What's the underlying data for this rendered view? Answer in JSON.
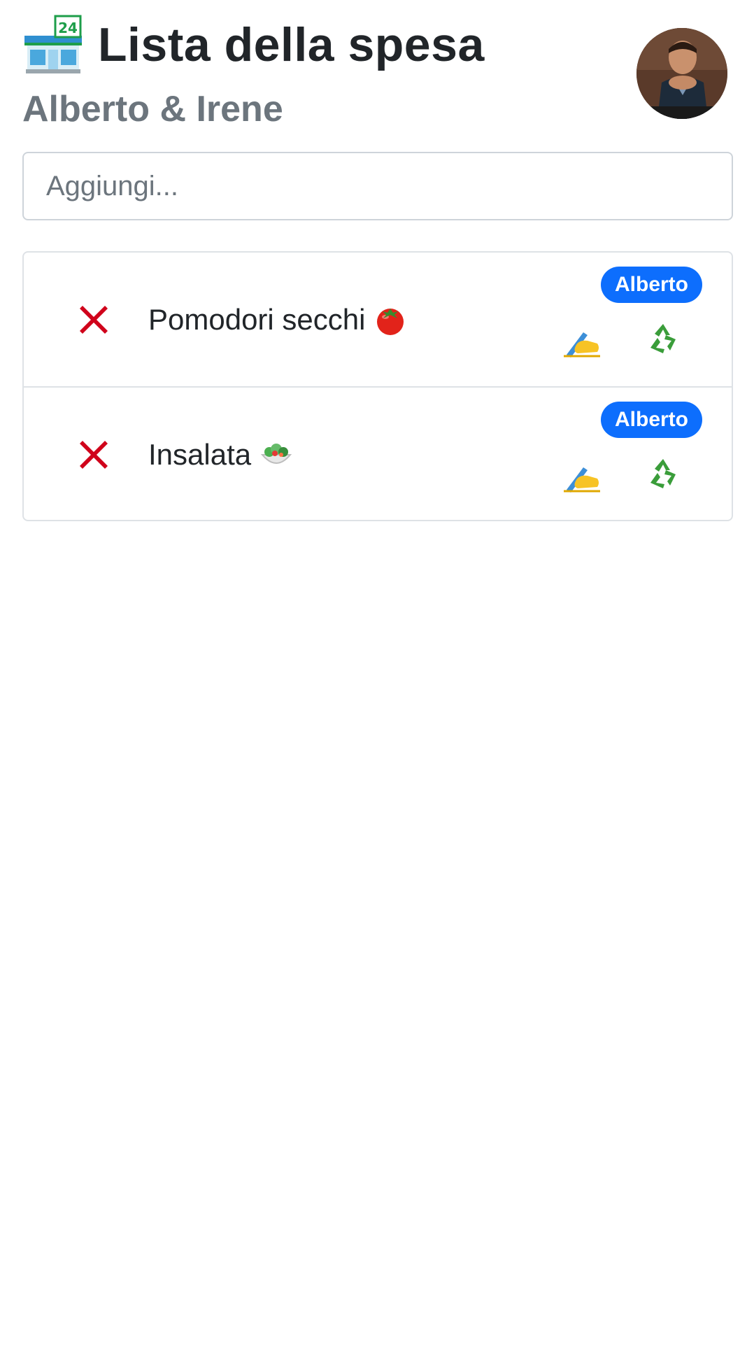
{
  "header": {
    "title": "Lista della spesa",
    "subtitle": "Alberto & Irene",
    "store_icon": "convenience-store-icon",
    "avatar": "user-avatar"
  },
  "add_item": {
    "placeholder": "Aggiungi..."
  },
  "items": [
    {
      "label": "Pomodori secchi",
      "emoji": "tomato-icon",
      "owner": "Alberto",
      "remove_icon": "cross-mark-icon",
      "edit_icon": "writing-hand-icon",
      "recycle_icon": "recycle-icon"
    },
    {
      "label": "Insalata",
      "emoji": "salad-icon",
      "owner": "Alberto",
      "remove_icon": "cross-mark-icon",
      "edit_icon": "writing-hand-icon",
      "recycle_icon": "recycle-icon"
    }
  ],
  "colors": {
    "badge": "#0d6efd",
    "title": "#212529",
    "subtitle": "#6c757d",
    "border": "#dee2e6",
    "remove": "#d0021b",
    "recycle": "#3a9d3a"
  }
}
